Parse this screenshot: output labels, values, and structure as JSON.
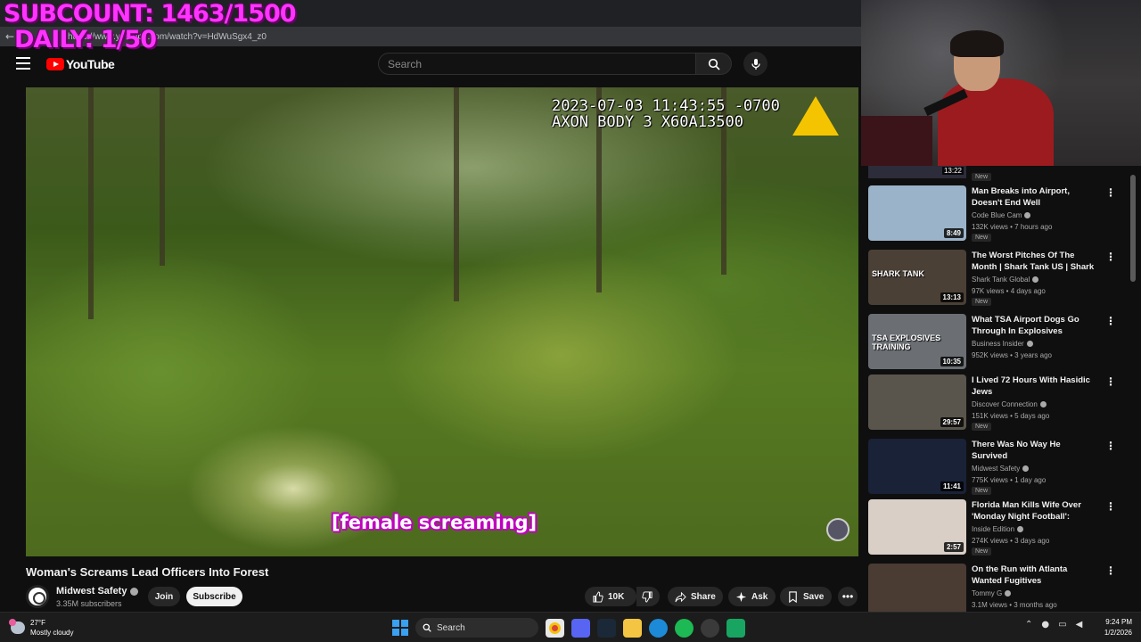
{
  "overlay": {
    "subcount": "SUBCOUNT: 1463/1500",
    "daily": "DAILY: 1/50"
  },
  "browser": {
    "url": "https://www.youtube.com/watch?v=HdWuSgx4_z0"
  },
  "header": {
    "logo_text": "YouTube",
    "search_placeholder": "Search"
  },
  "player": {
    "bodycam_line1": "2023-07-03 11:43:55 -0700",
    "bodycam_line2": "AXON BODY 3 X60A13500",
    "caption": "[female screaming]"
  },
  "video": {
    "title": "Woman's Screams Lead Officers Into Forest",
    "channel": "Midwest Safety",
    "subscribers": "3.35M subscribers",
    "join_label": "Join",
    "subscribe_label": "Subscribe",
    "likes": "10K",
    "share_label": "Share",
    "ask_label": "Ask",
    "save_label": "Save"
  },
  "sidebar": {
    "partial_duration": "13:22",
    "partial_badge": "New",
    "items": [
      {
        "title": "Man Breaks into Airport, Doesn't End Well",
        "channel": "Code Blue Cam",
        "meta": "132K views • 7 hours ago",
        "duration": "8:49",
        "badge": "New",
        "thumb": "#9bb3c9"
      },
      {
        "title": "The Worst Pitches Of The Month | Shark Tank US | Shark ...",
        "channel": "Shark Tank Global",
        "meta": "97K views • 4 days ago",
        "duration": "13:13",
        "badge": "New",
        "thumb": "#4a4036",
        "thumb_text": "SHARK TANK"
      },
      {
        "title": "What TSA Airport Dogs Go Through In Explosives Training...",
        "channel": "Business Insider",
        "meta": "952K views • 3 years ago",
        "duration": "10:35",
        "badge": "",
        "thumb": "#6b6f74",
        "thumb_text": "TSA EXPLOSIVES TRAINING"
      },
      {
        "title": "I Lived 72 Hours With Hasidic Jews",
        "channel": "Discover Connection",
        "meta": "151K views • 5 days ago",
        "duration": "29:57",
        "badge": "New",
        "thumb": "#5a554c"
      },
      {
        "title": "There Was No Way He Survived",
        "channel": "Midwest Safety",
        "meta": "775K views • 1 day ago",
        "duration": "11:41",
        "badge": "New",
        "thumb": "#1a2238"
      },
      {
        "title": "Florida Man Kills Wife Over 'Monday Night Football': Police",
        "channel": "Inside Edition",
        "meta": "274K views • 3 days ago",
        "duration": "2:57",
        "badge": "New",
        "thumb": "#d9cfc6"
      },
      {
        "title": "On the Run with Atlanta Wanted Fugitives",
        "channel": "Tommy G",
        "meta": "3.1M views • 3 months ago",
        "duration": "",
        "badge": "",
        "thumb": "#4a3b33"
      }
    ]
  },
  "taskbar": {
    "temp": "27°F",
    "weather": "Mostly cloudy",
    "search_label": "Search",
    "time": "9:24 PM",
    "date": "1/2/2026"
  }
}
